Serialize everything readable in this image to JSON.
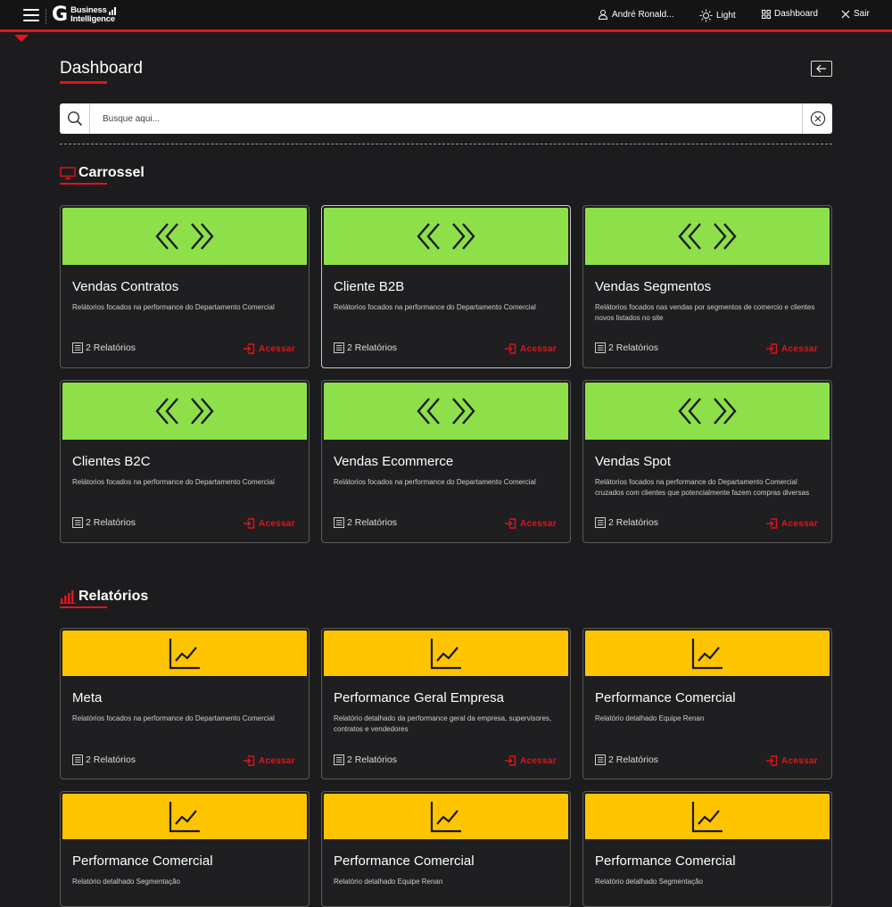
{
  "header": {
    "logo_letter": "G",
    "logo_line1": "Business",
    "logo_line2": "Intelligence",
    "user_name": "André Ronald...",
    "theme_label": "Light",
    "dashboard_label": "Dashboard",
    "exit_label": "Sair"
  },
  "page": {
    "title": "Dashboard"
  },
  "search": {
    "placeholder": "Busque aqui..."
  },
  "sections": {
    "carousel": {
      "title": "Carrossel",
      "cards": [
        {
          "title": "Vendas Contratos",
          "description": "Relátorios focados na performance do Departamento Comercial",
          "count": "2 Relatórios",
          "action": "Acessar"
        },
        {
          "title": "Cliente B2B",
          "description": "Relátorios focados na performance do Departamento Comercial",
          "count": "2 Relatórios",
          "action": "Acessar"
        },
        {
          "title": "Vendas Segmentos",
          "description": "Relátorios focados nas vendas por segmentos de comercio e clientes novos listados no site",
          "count": "2 Relatórios",
          "action": "Acessar"
        },
        {
          "title": "Clientes B2C",
          "description": "Relátorios focados na performance do Departamento Comercial",
          "count": "2 Relatórios",
          "action": "Acessar"
        },
        {
          "title": "Vendas Ecommerce",
          "description": "Relátorios focados na performance do Departamento Comercial",
          "count": "2 Relatórios",
          "action": "Acessar"
        },
        {
          "title": "Vendas Spot",
          "description": "Relátorios focados na performance do Departamento Comercial cruzados com clientes que potencialmente fazem compras diversas",
          "count": "2 Relatórios",
          "action": "Acessar"
        }
      ]
    },
    "reports": {
      "title": "Relatórios",
      "cards": [
        {
          "title": "Meta",
          "description": "Relatórios focados na performance do Departamento Comercial",
          "count": "2 Relatórios",
          "action": "Acessar"
        },
        {
          "title": "Performance Geral Empresa",
          "description": "Relatório detalhado da performance geral da empresa, supervisores, contratos e vendedores",
          "count": "2 Relatórios",
          "action": "Acessar"
        },
        {
          "title": "Performance Comercial",
          "description": "Relatório detalhado Equipe Renan",
          "count": "2 Relatórios",
          "action": "Acessar"
        },
        {
          "title": "Performance Comercial",
          "description": "Relatório detalhado Segmentação",
          "count": "",
          "action": ""
        },
        {
          "title": "Performance Comercial",
          "description": "Relatório detalhado Equipe Renan",
          "count": "",
          "action": ""
        },
        {
          "title": "Performance Comercial",
          "description": "Relatório detalhado Segmentação",
          "count": "",
          "action": ""
        }
      ]
    }
  },
  "colors": {
    "accent": "#e3141b",
    "carousel_banner": "#8ee04a",
    "report_banner": "#ffc400",
    "background": "#1c1c1e"
  },
  "icons": {
    "menu": "hamburger-icon",
    "user": "user-icon",
    "theme": "sun-icon",
    "dashboard": "grid-icon",
    "exit": "close-icon",
    "back": "arrow-left-icon",
    "search": "search-icon",
    "clear": "clear-circle-icon",
    "carousel_section": "monitor-icon",
    "reports_section": "bar-chart-icon",
    "carousel_banner": "double-chevron-icon",
    "report_banner": "line-chart-icon",
    "count": "list-icon",
    "access": "sign-in-icon"
  }
}
